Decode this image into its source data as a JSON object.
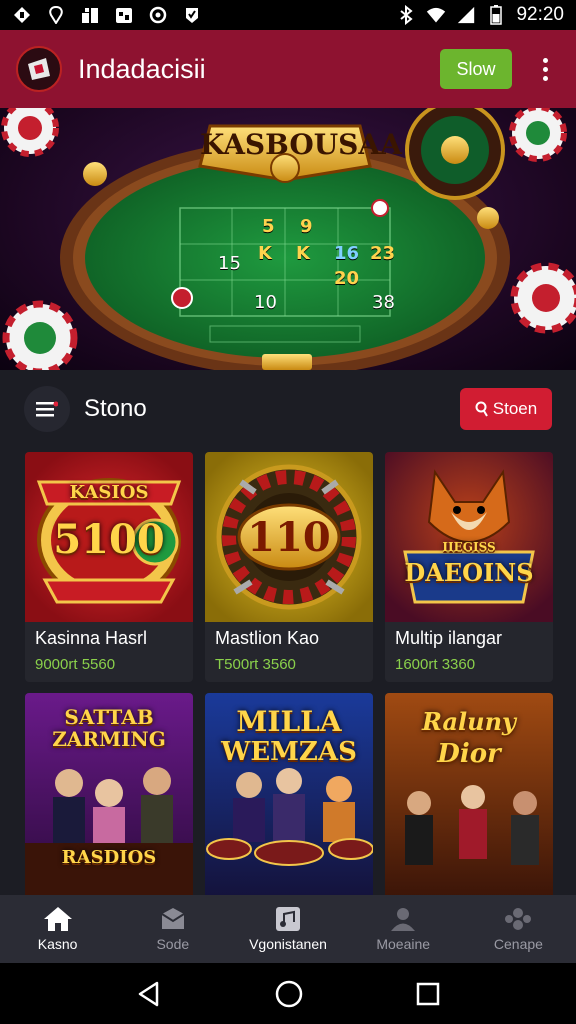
{
  "status_bar": {
    "time": "92:20",
    "left_icons": [
      "app-icon-1",
      "app-icon-2",
      "app-icon-3",
      "app-icon-4",
      "app-icon-5",
      "app-icon-6"
    ],
    "right_icons": [
      "bluetooth-icon",
      "wifi-icon",
      "signal-icon",
      "battery-icon"
    ]
  },
  "app_bar": {
    "title": "Indadacisii",
    "action_button": "Slow",
    "menu_icon": "kebab-menu-icon",
    "accent": "#8e1230",
    "button_color": "#6cb52e"
  },
  "hero": {
    "title": "KASBOUSAA",
    "badge": "5",
    "table_numbers": [
      "5",
      "9",
      "K",
      "K",
      "16",
      "23",
      "15",
      "20",
      "10",
      "38"
    ]
  },
  "section": {
    "title": "Stono",
    "search_label": "Stoen",
    "search_color": "#d11d32"
  },
  "games": [
    {
      "name": "Kasinna Hasrl",
      "meta": "9000rt 5560",
      "art_top": "KASIOS",
      "art_main": "5100"
    },
    {
      "name": "Mastlion Kao",
      "meta": "T500rt 3560",
      "art_top": "",
      "art_main": "110"
    },
    {
      "name": "Multip ilangar",
      "meta": "1600rt 3360",
      "art_top": "IIEGISS",
      "art_main": "DAEOINS"
    },
    {
      "name": "",
      "meta": "",
      "art_top": "SATTAB",
      "art_main": "ZARMING",
      "art_bottom": "RASDIOS"
    },
    {
      "name": "",
      "meta": "",
      "art_top": "MILLA",
      "art_main": "WEMZAS"
    },
    {
      "name": "",
      "meta": "",
      "art_top": "Raluny",
      "art_main": "Dior"
    }
  ],
  "bottom_nav": [
    {
      "label": "Kasno",
      "icon": "home-icon",
      "active": true
    },
    {
      "label": "Sode",
      "icon": "inbox-icon",
      "active": false
    },
    {
      "label": "Vgonistanen",
      "icon": "music-icon",
      "active": false
    },
    {
      "label": "Moeaine",
      "icon": "user-icon",
      "active": false
    },
    {
      "label": "Cenape",
      "icon": "group-icon",
      "active": false
    }
  ],
  "system_nav": [
    "back-icon",
    "home-circle-icon",
    "recents-icon"
  ]
}
